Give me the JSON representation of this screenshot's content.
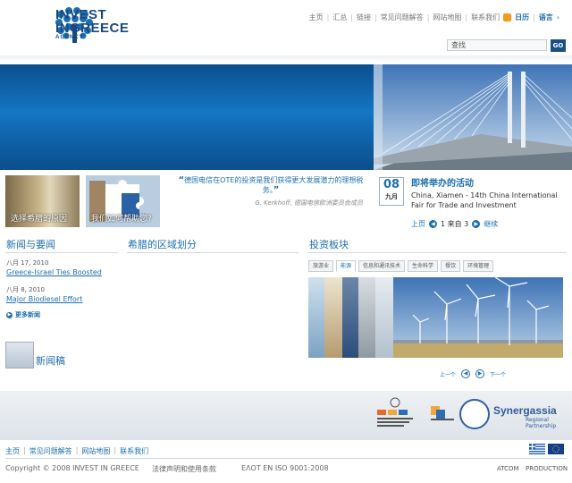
{
  "header": {
    "brand_line1": "INVEST",
    "brand_line2": "INGREECE",
    "brand_line3": "AGENCY",
    "topnav": [
      "主页",
      "汇总",
      "链接",
      "常见问题解答",
      "网站地图",
      "联系我们"
    ],
    "calendar_label": "日历",
    "language_label": "语言",
    "search_placeholder": "查找",
    "search_button": "GO"
  },
  "features": {
    "tile1_caption": "选择希腊的原因",
    "tile2_caption": "我们如何帮助您?",
    "quote_text": "德国电信在OTE的投资是我们获得更大发展潜力的理想税务。",
    "quote_author": "G. Kerkhoff, 德国电信欧洲委员会成员"
  },
  "event": {
    "day": "08",
    "month": "九月",
    "title": "即将举办的活动",
    "description": "China, Xiamen - 14th China International Fair for Trade and Investment",
    "nav_prev": "上页",
    "nav_page": "1 来自 3",
    "nav_next": "继续"
  },
  "news": {
    "title": "新闻与要闻",
    "items": [
      {
        "date": "八月 17, 2010",
        "link": "Greece-Israel Ties Boosted"
      },
      {
        "date": "八月 8, 2010",
        "link": "Major Biodiesel Effort"
      }
    ],
    "more_label": "更多新闻",
    "press_label": "新闻稿"
  },
  "regional": {
    "title": "希腊的区域划分"
  },
  "invest": {
    "title": "投资板块",
    "tabs": [
      "旅游业",
      "能源",
      "信息和通讯技术",
      "生命科学",
      "餐饮",
      "环境管理"
    ],
    "active_tab": "能源",
    "prev_label": "上一个",
    "next_label": "下一个"
  },
  "partners": {
    "synergassia_name": "Synergassia",
    "synergassia_sub": "Regional Partnership"
  },
  "footer": {
    "nav": [
      "主页",
      "常见问题解答",
      "网站地图",
      "联系我们"
    ],
    "copyright": "Copyright © 2008 INVEST IN GREECE",
    "legal": "法律声明和使用条款",
    "iso": "ΕΛΟΤ EN ISO 9001:2008",
    "atcom": "ATCOM",
    "production": "PRODUCTION"
  },
  "colors": {
    "accent": "#1c6fb0",
    "brand_navy": "#17497f",
    "hero_blue": "#0f5fa6"
  }
}
